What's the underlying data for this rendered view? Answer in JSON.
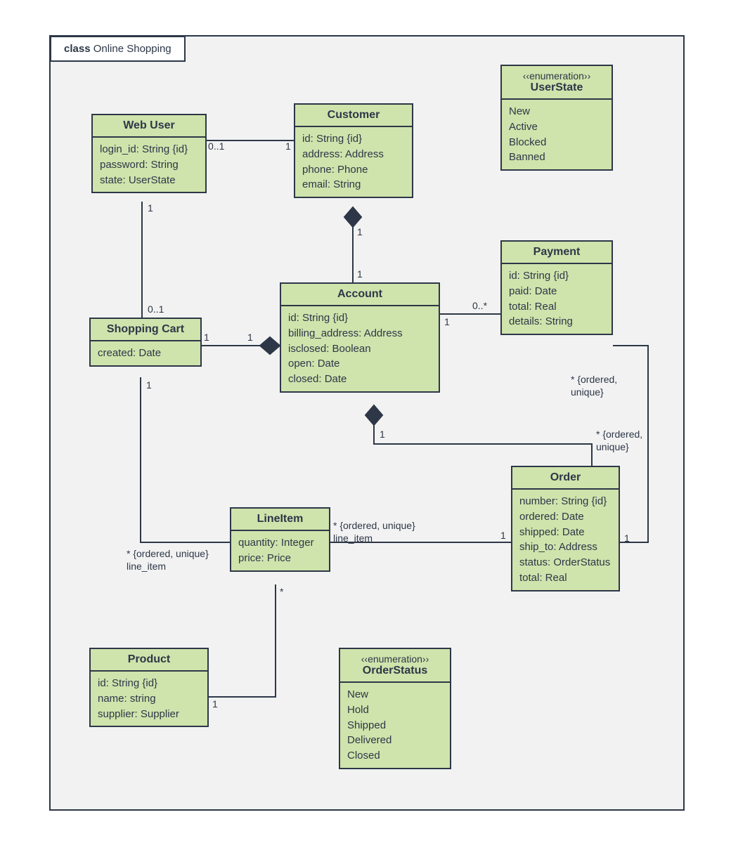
{
  "frame_title_prefix": "class",
  "frame_title": "Online Shopping",
  "classes": {
    "webuser": {
      "name": "Web User",
      "attrs": [
        "login_id: String {id}",
        "password: String",
        "state: UserState"
      ]
    },
    "customer": {
      "name": "Customer",
      "attrs": [
        "id: String {id}",
        "address: Address",
        "phone: Phone",
        "email: String"
      ]
    },
    "userstate": {
      "stereo": "‹‹enumeration››",
      "name": "UserState",
      "attrs": [
        "New",
        "Active",
        "Blocked",
        "Banned"
      ]
    },
    "cart": {
      "name": "Shopping Cart",
      "attrs": [
        "created: Date"
      ]
    },
    "account": {
      "name": "Account",
      "attrs": [
        "id: String {id}",
        "billing_address: Address",
        "isclosed: Boolean",
        "open: Date",
        "closed: Date"
      ]
    },
    "payment": {
      "name": "Payment",
      "attrs": [
        "id: String {id}",
        "paid: Date",
        "total: Real",
        "details: String"
      ]
    },
    "lineitem": {
      "name": "LineItem",
      "attrs": [
        "quantity: Integer",
        "price: Price"
      ]
    },
    "order": {
      "name": "Order",
      "attrs": [
        "number: String {id}",
        "ordered: Date",
        "shipped: Date",
        "ship_to: Address",
        "status: OrderStatus",
        "total: Real"
      ]
    },
    "product": {
      "name": "Product",
      "attrs": [
        "id: String {id}",
        "name: string",
        "supplier: Supplier"
      ]
    },
    "orderstatus": {
      "stereo": "‹‹enumeration››",
      "name": "OrderStatus",
      "attrs": [
        "New",
        "Hold",
        "Shipped",
        "Delivered",
        "Closed"
      ]
    }
  },
  "labels": {
    "wu_cu_l": "0..1",
    "wu_cu_r": "1",
    "wu_cart_t": "1",
    "wu_cart_b": "0..1",
    "cu_acc_t": "1",
    "cu_acc_b": "1",
    "cart_acc_l": "1",
    "cart_acc_r": "1",
    "acc_pay_l": "1",
    "acc_pay_r": "0..*",
    "acc_ord_l": "1",
    "acc_ord_r": "* {ordered,\nunique}",
    "pay_ord_t": "* {ordered,\nunique}",
    "pay_ord_b": "1",
    "cart_li_t": "1",
    "cart_li_b": "* {ordered, unique}\nline_item",
    "ord_li_r": "1",
    "ord_li_l": "* {ordered, unique}\nline_item",
    "li_prod_t": "*",
    "li_prod_b": "1"
  }
}
